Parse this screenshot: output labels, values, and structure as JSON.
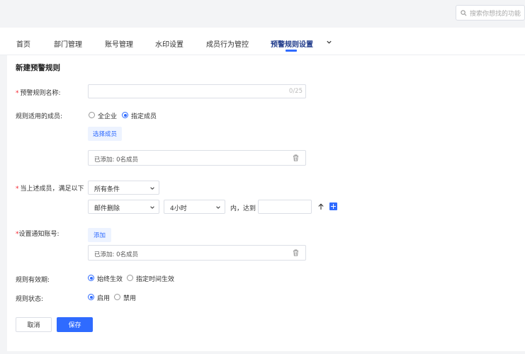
{
  "search": {
    "placeholder": "搜索你想找的功能"
  },
  "nav": {
    "tabs": [
      {
        "label": "首页"
      },
      {
        "label": "部门管理"
      },
      {
        "label": "账号管理"
      },
      {
        "label": "水印设置"
      },
      {
        "label": "成员行为管控"
      },
      {
        "label": "预警规则设置",
        "active": true
      }
    ]
  },
  "page": {
    "title": "新建预警规则"
  },
  "form": {
    "rule_name": {
      "label": "预警规则名称:",
      "required_mark": "*",
      "value": "",
      "counter": "0/25"
    },
    "members": {
      "label": "规则适用的成员:",
      "options": [
        "全企业",
        "指定成员"
      ],
      "selected": "指定成员",
      "select_button": "选择成员",
      "added_text": "已添加: 0名成员"
    },
    "condition": {
      "label": "当上述成员，满足以下",
      "required_mark": "*",
      "match_select": "所有条件",
      "action_select": "邮件删除",
      "time_select": "4小时",
      "within_text": "内，达到",
      "threshold_value": ""
    },
    "notify": {
      "label": "设置通知账号:",
      "required_mark": "*",
      "add_button": "添加",
      "added_text": "已添加: 0名成员"
    },
    "validity": {
      "label": "规则有效期:",
      "options": [
        "始终生效",
        "指定时间生效"
      ],
      "selected": "始终生效"
    },
    "status": {
      "label": "规则状态:",
      "options": [
        "启用",
        "禁用"
      ],
      "selected": "启用"
    }
  },
  "actions": {
    "cancel": "取消",
    "save": "保存"
  },
  "colors": {
    "primary": "#2f6bff",
    "required": "#f5222d",
    "active_tab": "#1f3a8a"
  }
}
